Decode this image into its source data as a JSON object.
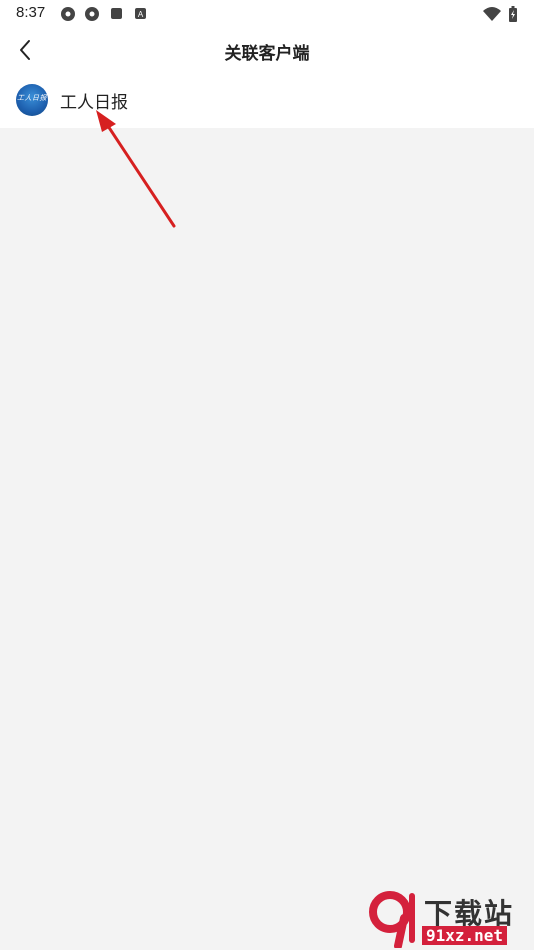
{
  "status_bar": {
    "time": "8:37",
    "icons": [
      "camera-shutter-icon",
      "camera-shutter-icon",
      "stop-square-icon",
      "a-badge-icon",
      "wifi-icon",
      "battery-charging-icon"
    ]
  },
  "header": {
    "back_icon": "chevron-left-icon",
    "title": "关联客户端"
  },
  "clients": [
    {
      "name": "工人日报",
      "logo_text": "工人日报"
    }
  ],
  "watermark": {
    "text": "下载站",
    "url": "91xz.net"
  },
  "colors": {
    "background": "#f3f3f3",
    "surface": "#ffffff",
    "arrow": "#d62020",
    "logo_blue": "#1d5fae",
    "watermark_red": "#d4213c"
  }
}
